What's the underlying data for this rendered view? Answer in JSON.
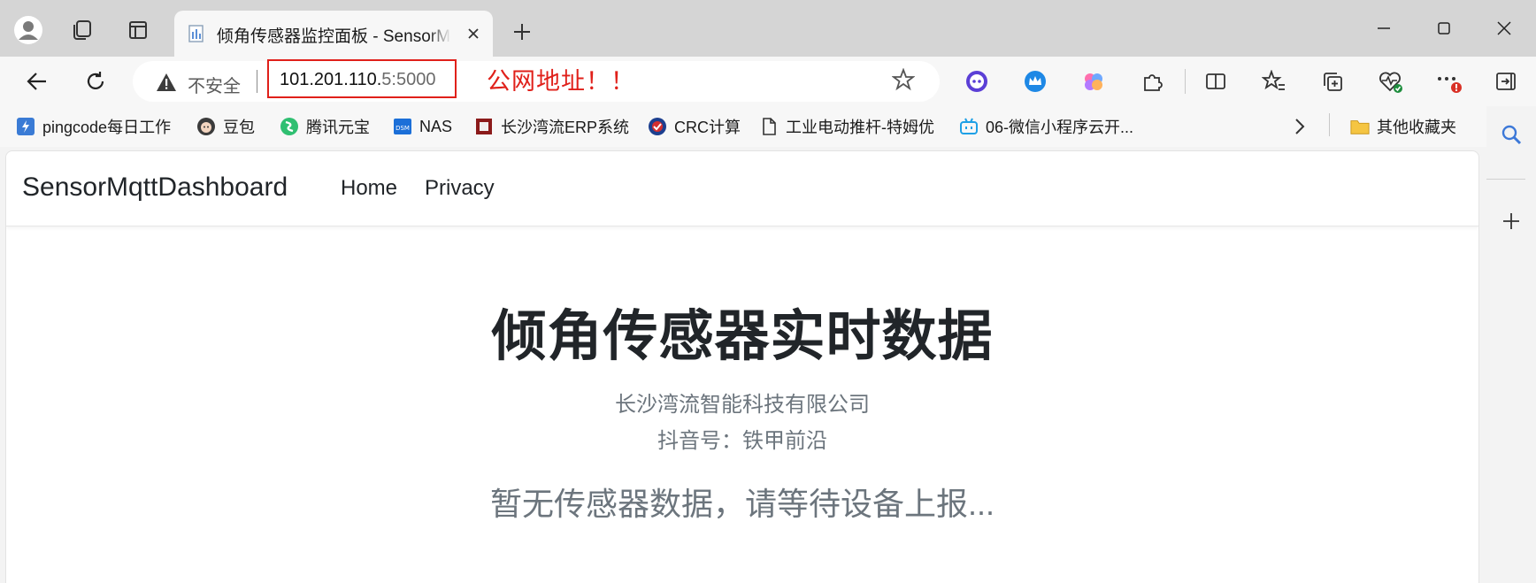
{
  "browser": {
    "tab": {
      "title": "倾角传感器监控面板 - SensorMqttDashboard"
    },
    "address": {
      "security_label": "不安全",
      "url_main": "101.201.110.",
      "url_tail": "5:5000"
    },
    "annotation": {
      "text": "公网地址！！",
      "color": "#e0201a"
    },
    "bookmarks": [
      {
        "label": "pingcode每日工作",
        "icon": "pingcode-icon"
      },
      {
        "label": "豆包",
        "icon": "doubao-avatar-icon"
      },
      {
        "label": "腾讯元宝",
        "icon": "yuanbao-icon"
      },
      {
        "label": "NAS",
        "icon": "dsm-icon"
      },
      {
        "label": "长沙湾流ERP系统",
        "icon": "erp-icon"
      },
      {
        "label": "CRC计算",
        "icon": "crc-icon"
      },
      {
        "label": "工业电动推杆-特姆优",
        "icon": "page-icon"
      },
      {
        "label": "06-微信小程序云开...",
        "icon": "bilibili-icon"
      }
    ],
    "other_bookmarks": "其他收藏夹"
  },
  "site": {
    "brand": "SensorMqttDashboard",
    "nav": [
      "Home",
      "Privacy"
    ],
    "title": "倾角传感器实时数据",
    "company": "长沙湾流智能科技有限公司",
    "douyin": "抖音号：铁甲前沿",
    "empty_message": "暂无传感器数据，请等待设备上报..."
  },
  "colors": {
    "text_primary": "#212529",
    "text_muted": "#6c757d",
    "accent_red": "#e0201a"
  }
}
